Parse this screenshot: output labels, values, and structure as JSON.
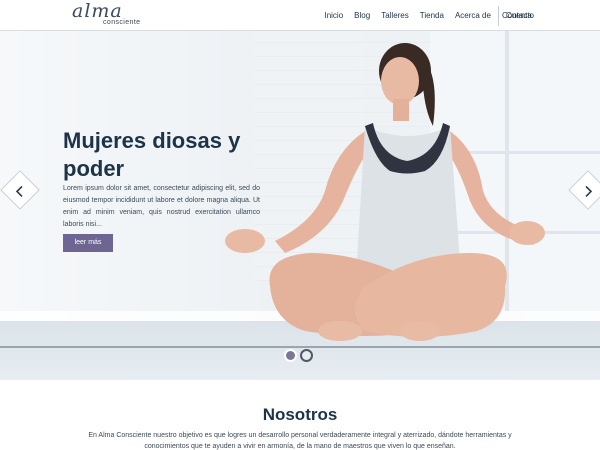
{
  "header": {
    "logo_script": "alma",
    "logo_sub": "consciente",
    "nav": [
      "Inicio",
      "Blog",
      "Talleres",
      "Tienda",
      "Acerca de",
      "Contacto"
    ],
    "account": "Cuenta"
  },
  "hero": {
    "title": "Mujeres diosas y poder",
    "text": "Lorem ipsum dolor sit amet, consectetur adipiscing elit, sed do eiusmod tempor incididunt ut labore et dolore magna aliqua. Ut enim ad minim veniam, quis nostrud exercitation ullamco laboris nisi...",
    "button": "leer más",
    "slide_index": 1,
    "slide_count": 2
  },
  "about": {
    "title": "Nosotros",
    "text": "En Alma Consciente nuestro objetivo es que logres un desarrollo personal verdaderamente integral y aterrizado, dándote herramientas y conocimientos que te ayuden a vivir en armonía, de la mano de maestros que viven lo que enseñan."
  },
  "colors": {
    "accent": "#6e6593",
    "text_dark": "#1d3347",
    "dot_active": "#7b7598"
  },
  "icons": {
    "prev": "chevron-left-icon",
    "next": "chevron-right-icon"
  }
}
